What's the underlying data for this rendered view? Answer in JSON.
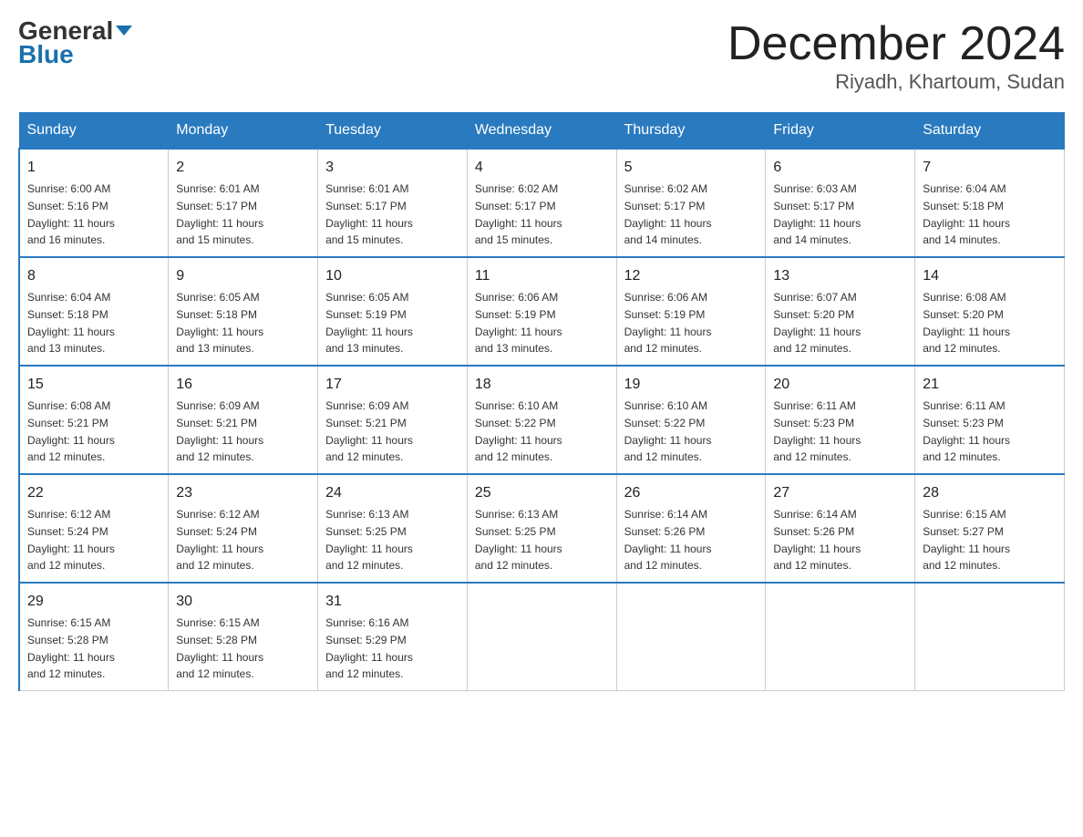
{
  "header": {
    "logo_line1": "General",
    "logo_line2": "Blue",
    "month_title": "December 2024",
    "subtitle": "Riyadh, Khartoum, Sudan"
  },
  "days_of_week": [
    "Sunday",
    "Monday",
    "Tuesday",
    "Wednesday",
    "Thursday",
    "Friday",
    "Saturday"
  ],
  "weeks": [
    [
      {
        "day": "1",
        "sunrise": "6:00 AM",
        "sunset": "5:16 PM",
        "daylight": "11 hours and 16 minutes."
      },
      {
        "day": "2",
        "sunrise": "6:01 AM",
        "sunset": "5:17 PM",
        "daylight": "11 hours and 15 minutes."
      },
      {
        "day": "3",
        "sunrise": "6:01 AM",
        "sunset": "5:17 PM",
        "daylight": "11 hours and 15 minutes."
      },
      {
        "day": "4",
        "sunrise": "6:02 AM",
        "sunset": "5:17 PM",
        "daylight": "11 hours and 15 minutes."
      },
      {
        "day": "5",
        "sunrise": "6:02 AM",
        "sunset": "5:17 PM",
        "daylight": "11 hours and 14 minutes."
      },
      {
        "day": "6",
        "sunrise": "6:03 AM",
        "sunset": "5:17 PM",
        "daylight": "11 hours and 14 minutes."
      },
      {
        "day": "7",
        "sunrise": "6:04 AM",
        "sunset": "5:18 PM",
        "daylight": "11 hours and 14 minutes."
      }
    ],
    [
      {
        "day": "8",
        "sunrise": "6:04 AM",
        "sunset": "5:18 PM",
        "daylight": "11 hours and 13 minutes."
      },
      {
        "day": "9",
        "sunrise": "6:05 AM",
        "sunset": "5:18 PM",
        "daylight": "11 hours and 13 minutes."
      },
      {
        "day": "10",
        "sunrise": "6:05 AM",
        "sunset": "5:19 PM",
        "daylight": "11 hours and 13 minutes."
      },
      {
        "day": "11",
        "sunrise": "6:06 AM",
        "sunset": "5:19 PM",
        "daylight": "11 hours and 13 minutes."
      },
      {
        "day": "12",
        "sunrise": "6:06 AM",
        "sunset": "5:19 PM",
        "daylight": "11 hours and 12 minutes."
      },
      {
        "day": "13",
        "sunrise": "6:07 AM",
        "sunset": "5:20 PM",
        "daylight": "11 hours and 12 minutes."
      },
      {
        "day": "14",
        "sunrise": "6:08 AM",
        "sunset": "5:20 PM",
        "daylight": "11 hours and 12 minutes."
      }
    ],
    [
      {
        "day": "15",
        "sunrise": "6:08 AM",
        "sunset": "5:21 PM",
        "daylight": "11 hours and 12 minutes."
      },
      {
        "day": "16",
        "sunrise": "6:09 AM",
        "sunset": "5:21 PM",
        "daylight": "11 hours and 12 minutes."
      },
      {
        "day": "17",
        "sunrise": "6:09 AM",
        "sunset": "5:21 PM",
        "daylight": "11 hours and 12 minutes."
      },
      {
        "day": "18",
        "sunrise": "6:10 AM",
        "sunset": "5:22 PM",
        "daylight": "11 hours and 12 minutes."
      },
      {
        "day": "19",
        "sunrise": "6:10 AM",
        "sunset": "5:22 PM",
        "daylight": "11 hours and 12 minutes."
      },
      {
        "day": "20",
        "sunrise": "6:11 AM",
        "sunset": "5:23 PM",
        "daylight": "11 hours and 12 minutes."
      },
      {
        "day": "21",
        "sunrise": "6:11 AM",
        "sunset": "5:23 PM",
        "daylight": "11 hours and 12 minutes."
      }
    ],
    [
      {
        "day": "22",
        "sunrise": "6:12 AM",
        "sunset": "5:24 PM",
        "daylight": "11 hours and 12 minutes."
      },
      {
        "day": "23",
        "sunrise": "6:12 AM",
        "sunset": "5:24 PM",
        "daylight": "11 hours and 12 minutes."
      },
      {
        "day": "24",
        "sunrise": "6:13 AM",
        "sunset": "5:25 PM",
        "daylight": "11 hours and 12 minutes."
      },
      {
        "day": "25",
        "sunrise": "6:13 AM",
        "sunset": "5:25 PM",
        "daylight": "11 hours and 12 minutes."
      },
      {
        "day": "26",
        "sunrise": "6:14 AM",
        "sunset": "5:26 PM",
        "daylight": "11 hours and 12 minutes."
      },
      {
        "day": "27",
        "sunrise": "6:14 AM",
        "sunset": "5:26 PM",
        "daylight": "11 hours and 12 minutes."
      },
      {
        "day": "28",
        "sunrise": "6:15 AM",
        "sunset": "5:27 PM",
        "daylight": "11 hours and 12 minutes."
      }
    ],
    [
      {
        "day": "29",
        "sunrise": "6:15 AM",
        "sunset": "5:28 PM",
        "daylight": "11 hours and 12 minutes."
      },
      {
        "day": "30",
        "sunrise": "6:15 AM",
        "sunset": "5:28 PM",
        "daylight": "11 hours and 12 minutes."
      },
      {
        "day": "31",
        "sunrise": "6:16 AM",
        "sunset": "5:29 PM",
        "daylight": "11 hours and 12 minutes."
      },
      null,
      null,
      null,
      null
    ]
  ]
}
